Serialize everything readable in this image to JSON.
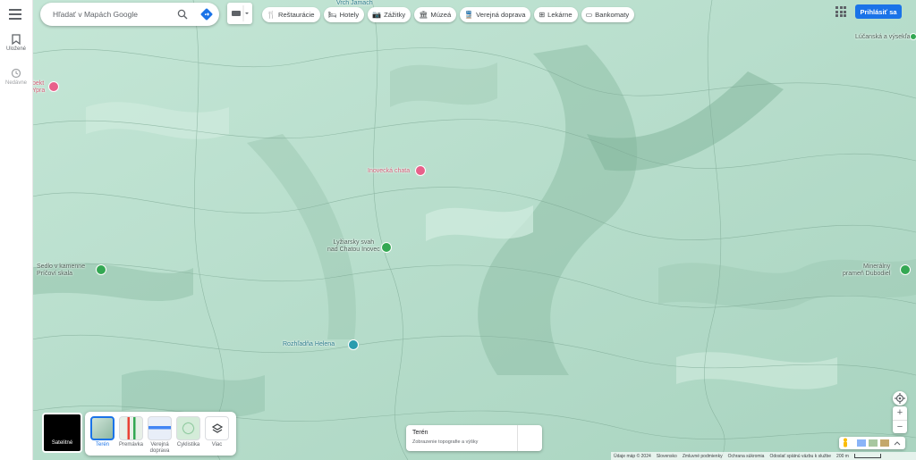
{
  "sidebar": {
    "saved_label": "Uložené",
    "recent_label": "Nedávne"
  },
  "search": {
    "placeholder": "Hľadať v Mapách Google"
  },
  "chips": [
    {
      "label": "Reštaurácie",
      "icon": "fork-knife-icon"
    },
    {
      "label": "Hotely",
      "icon": "bed-icon"
    },
    {
      "label": "Zážitky",
      "icon": "camera-icon"
    },
    {
      "label": "Múzeá",
      "icon": "museum-icon"
    },
    {
      "label": "Verejná doprava",
      "icon": "train-icon"
    },
    {
      "label": "Lekárne",
      "icon": "pharmacy-icon"
    },
    {
      "label": "Bankomaty",
      "icon": "atm-icon"
    }
  ],
  "header": {
    "signin_label": "Prihlásiť sa"
  },
  "map_labels": {
    "inovecka_chata": "Inovecká chata",
    "lyziarsky_svah": "Lyžiarsky svah\nnad Chatou Inovec",
    "rozhladna": "Rozhľadňa Helena",
    "left_poi_top": "bekt",
    "left_poi_top2": "Ypra",
    "left_green": "Sedlo v kamenne\nPríčoví skala",
    "right_green": "Minerálny\nprameň Dubodiel",
    "top_right": "Lúčanská a výsekľa",
    "top_center": "Vrch Jamach"
  },
  "layers": {
    "active_label": "Satelitné",
    "items": [
      {
        "label": "Terén",
        "selected": true
      },
      {
        "label": "Premávka",
        "selected": false
      },
      {
        "label": "Verejná\ndoprava",
        "selected": false
      },
      {
        "label": "Cyklistika",
        "selected": false
      },
      {
        "label": "Viac",
        "selected": false
      }
    ]
  },
  "terrain_card": {
    "title": "Terén",
    "subtitle": "Zobrazenie topografie a výšky"
  },
  "footer": {
    "items": [
      "Údaje máp © 2024",
      "Slovensko",
      "Zmluvné podmienky",
      "Ochrana súkromia",
      "Odoslať spätnú väzbu k službe"
    ],
    "scale": "200 m"
  },
  "colors": {
    "terrain_base": "#b6dccb",
    "accent": "#1a73e8",
    "poi_red": "#e8608a",
    "poi_green": "#34a853"
  }
}
